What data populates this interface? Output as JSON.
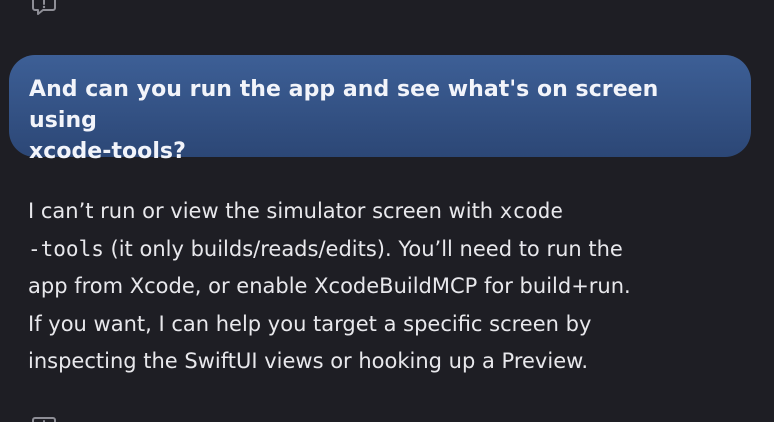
{
  "icons": {
    "top": "feedback-icon",
    "bottom": "feedback-icon"
  },
  "user_message": {
    "text": "And can you run the app and see what's on screen using\nxcode-tools?"
  },
  "assistant_message": {
    "line1_text": "I can’t run or view the simulator screen with ",
    "line1_code": "xcode",
    "line2_code": "-tools",
    "line2_text": " (it only builds/reads/edits). You’ll need to run the",
    "line3": "app from Xcode, or enable XcodeBuildMCP for build+run.",
    "line4": "If you want, I can help you target a specific screen by",
    "line5": "inspecting the SwiftUI views or hooking up a Preview."
  },
  "colors": {
    "background": "#1e1e24",
    "user_bubble": "#355487",
    "text": "#e8e8ec"
  }
}
